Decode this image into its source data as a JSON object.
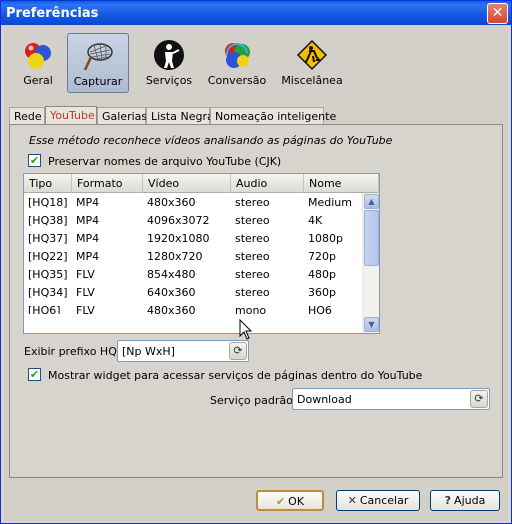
{
  "window": {
    "title": "Preferências",
    "close_glyph": "✕"
  },
  "toolbar": {
    "items": [
      {
        "label": "Geral",
        "icon": "balls-icon"
      },
      {
        "label": "Capturar",
        "icon": "net-icon"
      },
      {
        "label": "Serviços",
        "icon": "service-person-icon"
      },
      {
        "label": "Conversão",
        "icon": "conversion-balls-icon"
      },
      {
        "label": "Miscelânea",
        "icon": "construction-sign-icon"
      }
    ],
    "active": "Capturar"
  },
  "tabs": [
    {
      "label": "Rede"
    },
    {
      "label": "YouTube"
    },
    {
      "label": "Galerias"
    },
    {
      "label": "Lista Negra"
    },
    {
      "label": "Nomeação inteligente"
    }
  ],
  "active_tab": "YouTube",
  "youtube": {
    "description": "Esse método reconhece vídeos analisando as páginas do YouTube",
    "preserve_names": {
      "label": "Preservar nomes de arquivo YouTube (CJK)",
      "checked": true
    },
    "table": {
      "headers": [
        "Tipo",
        "Formato",
        "Vídeo",
        "Audio",
        "Nome"
      ],
      "rows": [
        [
          "[HQ18]",
          "MP4",
          "480x360",
          "stereo",
          "Medium"
        ],
        [
          "[HQ38]",
          "MP4",
          "4096x3072",
          "stereo",
          "4K"
        ],
        [
          "[HQ37]",
          "MP4",
          "1920x1080",
          "stereo",
          "1080p"
        ],
        [
          "[HQ22]",
          "MP4",
          "1280x720",
          "stereo",
          "720p"
        ],
        [
          "[HQ35]",
          "FLV",
          "854x480",
          "stereo",
          "480p"
        ],
        [
          "[HQ34]",
          "FLV",
          "640x360",
          "stereo",
          "360p"
        ],
        [
          "[HQ6]",
          "FLV",
          "480x360",
          "mono",
          "HQ6"
        ]
      ],
      "scroll_up": "▲",
      "scroll_down": "▼"
    },
    "prefix": {
      "label": "Exibir prefixo HQ",
      "value": "[Np WxH]"
    },
    "widget": {
      "label": "Mostrar widget para acessar serviços de páginas dentro do YouTube",
      "checked": true
    },
    "default_service": {
      "label": "Serviço padrão",
      "value": "Download"
    },
    "check_glyph": "✔",
    "combo_glyph": "⟳"
  },
  "buttons": {
    "ok": {
      "label": "OK",
      "glyph": "✔"
    },
    "cancel": {
      "label": "Cancelar",
      "glyph": "✕"
    },
    "help": {
      "label": "Ajuda",
      "glyph": "?"
    }
  },
  "colors": {
    "title_bar": "#0a5ce8",
    "active_tab_text": "#c0392b",
    "check": "#21a121"
  }
}
